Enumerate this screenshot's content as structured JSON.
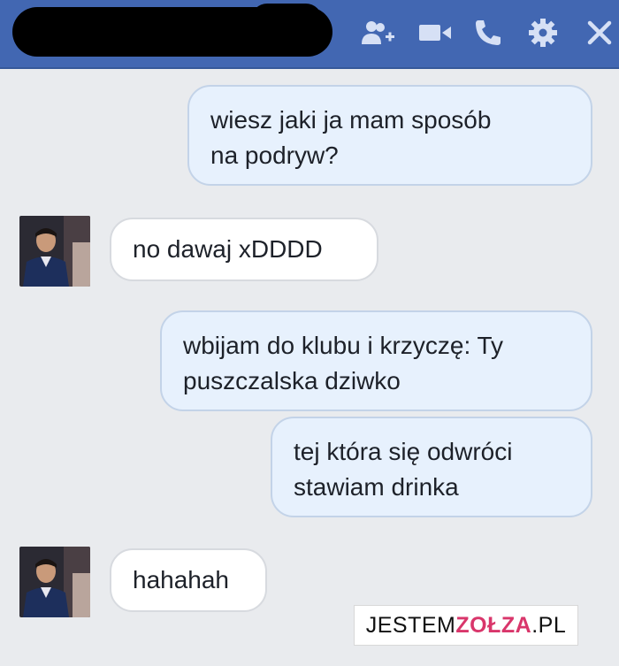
{
  "header": {
    "icons": [
      "add-people-icon",
      "video-call-icon",
      "phone-icon",
      "gear-icon",
      "close-icon"
    ],
    "colors": {
      "bar": "#4267b2",
      "icon": "#ffffff"
    }
  },
  "messages": [
    {
      "side": "sent",
      "text": "wiesz jaki ja mam sposób\nna podryw?"
    },
    {
      "side": "received",
      "text": "no dawaj xDDDD"
    },
    {
      "side": "sent",
      "text": "wbijam do klubu i krzyczę: Ty\npuszczalska dziwko"
    },
    {
      "side": "sent",
      "text": "tej która się odwróci\nstawiam drinka"
    },
    {
      "side": "received",
      "text": "hahahah"
    }
  ],
  "watermark": {
    "part1": "JESTEM",
    "part2": "ZOŁZA",
    "part3": ".PL"
  }
}
